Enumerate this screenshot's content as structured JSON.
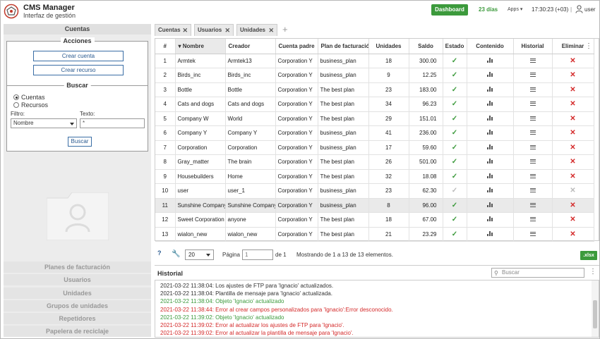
{
  "header": {
    "title": "CMS Manager",
    "subtitle": "Interfaz de gestión",
    "dashboard_label": "Dashboard",
    "days_label": "23 días",
    "apps_label": "Apps",
    "clock": "17:30:23 (+03)",
    "separator": "|",
    "user": "user"
  },
  "sidebar": {
    "title": "Cuentas",
    "acciones": {
      "legend": "Acciones",
      "create_account": "Crear cuenta",
      "create_resource": "Crear recurso"
    },
    "buscar": {
      "legend": "Buscar",
      "radio_accounts": "Cuentas",
      "radio_resources": "Recursos",
      "filter_label": "Filtro:",
      "filter_value": "Nombre",
      "text_label": "Texto:",
      "text_value": "*",
      "search_button": "Buscar"
    },
    "menu": [
      "Planes de facturación",
      "Usuarios",
      "Unidades",
      "Grupos de unidades",
      "Repetidores",
      "Papelera de reciclaje"
    ]
  },
  "tabs": [
    {
      "label": "Cuentas",
      "close": "✕"
    },
    {
      "label": "Usuarios",
      "close": "✕"
    },
    {
      "label": "Unidades",
      "close": "✕"
    }
  ],
  "tab_add": "+",
  "table": {
    "columns": [
      "#",
      "Nombre",
      "Creador",
      "Cuenta padre",
      "Plan de facturación",
      "Unidades",
      "Saldo",
      "Estado",
      "Contenido",
      "Historial",
      "Eliminar"
    ],
    "rows": [
      {
        "n": "1",
        "name": "Armtek",
        "creator": "Armtek13",
        "parent": "Corporation Y",
        "plan": "business_plan",
        "units": "18",
        "balance": "300.00",
        "active": true,
        "highlight": false
      },
      {
        "n": "2",
        "name": "Birds_inc",
        "creator": "Birds_inc",
        "parent": "Corporation Y",
        "plan": "business_plan",
        "units": "9",
        "balance": "12.25",
        "active": true,
        "highlight": false
      },
      {
        "n": "3",
        "name": "Bottle",
        "creator": "Bottle",
        "parent": "Corporation Y",
        "plan": "The best plan",
        "units": "23",
        "balance": "183.00",
        "active": true,
        "highlight": false
      },
      {
        "n": "4",
        "name": "Cats and dogs",
        "creator": "Cats and dogs",
        "parent": "Corporation Y",
        "plan": "The best plan",
        "units": "34",
        "balance": "96.23",
        "active": true,
        "highlight": false
      },
      {
        "n": "5",
        "name": "Company W",
        "creator": "World",
        "parent": "Corporation Y",
        "plan": "The best plan",
        "units": "29",
        "balance": "151.01",
        "active": true,
        "highlight": false
      },
      {
        "n": "6",
        "name": "Company Y",
        "creator": "Company Y",
        "parent": "Corporation Y",
        "plan": "business_plan",
        "units": "41",
        "balance": "236.00",
        "active": true,
        "highlight": false
      },
      {
        "n": "7",
        "name": "Corporation",
        "creator": "Corporation",
        "parent": "Corporation Y",
        "plan": "business_plan",
        "units": "17",
        "balance": "59.60",
        "active": true,
        "highlight": false
      },
      {
        "n": "8",
        "name": "Gray_matter",
        "creator": "The brain",
        "parent": "Corporation Y",
        "plan": "The best plan",
        "units": "26",
        "balance": "501.00",
        "active": true,
        "highlight": false
      },
      {
        "n": "9",
        "name": "Housebuilders",
        "creator": "Home",
        "parent": "Corporation Y",
        "plan": "The best plan",
        "units": "32",
        "balance": "18.08",
        "active": true,
        "highlight": false
      },
      {
        "n": "10",
        "name": "user",
        "creator": "user_1",
        "parent": "Corporation Y",
        "plan": "business_plan",
        "units": "23",
        "balance": "62.30",
        "active": false,
        "highlight": false
      },
      {
        "n": "11",
        "name": "Sunshine Company",
        "creator": "Sunshine Company",
        "parent": "Corporation Y",
        "plan": "business_plan",
        "units": "8",
        "balance": "96.00",
        "active": true,
        "highlight": true
      },
      {
        "n": "12",
        "name": "Sweet Corporation",
        "creator": "anyone",
        "parent": "Corporation Y",
        "plan": "The best plan",
        "units": "18",
        "balance": "67.00",
        "active": true,
        "highlight": false
      },
      {
        "n": "13",
        "name": "wialon_new",
        "creator": "wialon_new",
        "parent": "Corporation Y",
        "plan": "The best plan",
        "units": "21",
        "balance": "23.29",
        "active": true,
        "highlight": false
      }
    ]
  },
  "pager": {
    "help": "?",
    "page_size": "20",
    "page_label": "Página",
    "page_value": "1",
    "of_label": "de 1",
    "showing": "Mostrando de 1 a 13 de 13 elementos.",
    "export": ".xlsx"
  },
  "history": {
    "title": "Historial",
    "search_placeholder": "Buscar",
    "entries": [
      {
        "text": "2021-03-22 11:38:04: Los ajustes de FTP para 'Ignacio' actualizados.",
        "kind": "n"
      },
      {
        "text": "2021-03-22 11:38:04: Plantilla de mensaje para 'Ignacio' actualizada.",
        "kind": "n"
      },
      {
        "text": "2021-03-22 11:38:04: Objeto 'Ignacio' actualizado",
        "kind": "g"
      },
      {
        "text": "2021-03-22 11:38:44: Error al crear campos personalizados para 'Ignacio':Error desconocido.",
        "kind": "e"
      },
      {
        "text": "2021-03-22 11:39:02: Objeto 'Ignacio' actualizado",
        "kind": "g"
      },
      {
        "text": "2021-03-22 11:39:02: Error al actualizar los ajustes de FTP para 'Ignacio'.",
        "kind": "e"
      },
      {
        "text": "2021-03-22 11:39:02: Error al actualizar la plantilla de mensaje para 'Ignacio'.",
        "kind": "e"
      }
    ]
  },
  "colors": {
    "accent_green": "#3c9a3c",
    "error_red": "#d42a2a",
    "link_blue": "#2a5a90"
  }
}
